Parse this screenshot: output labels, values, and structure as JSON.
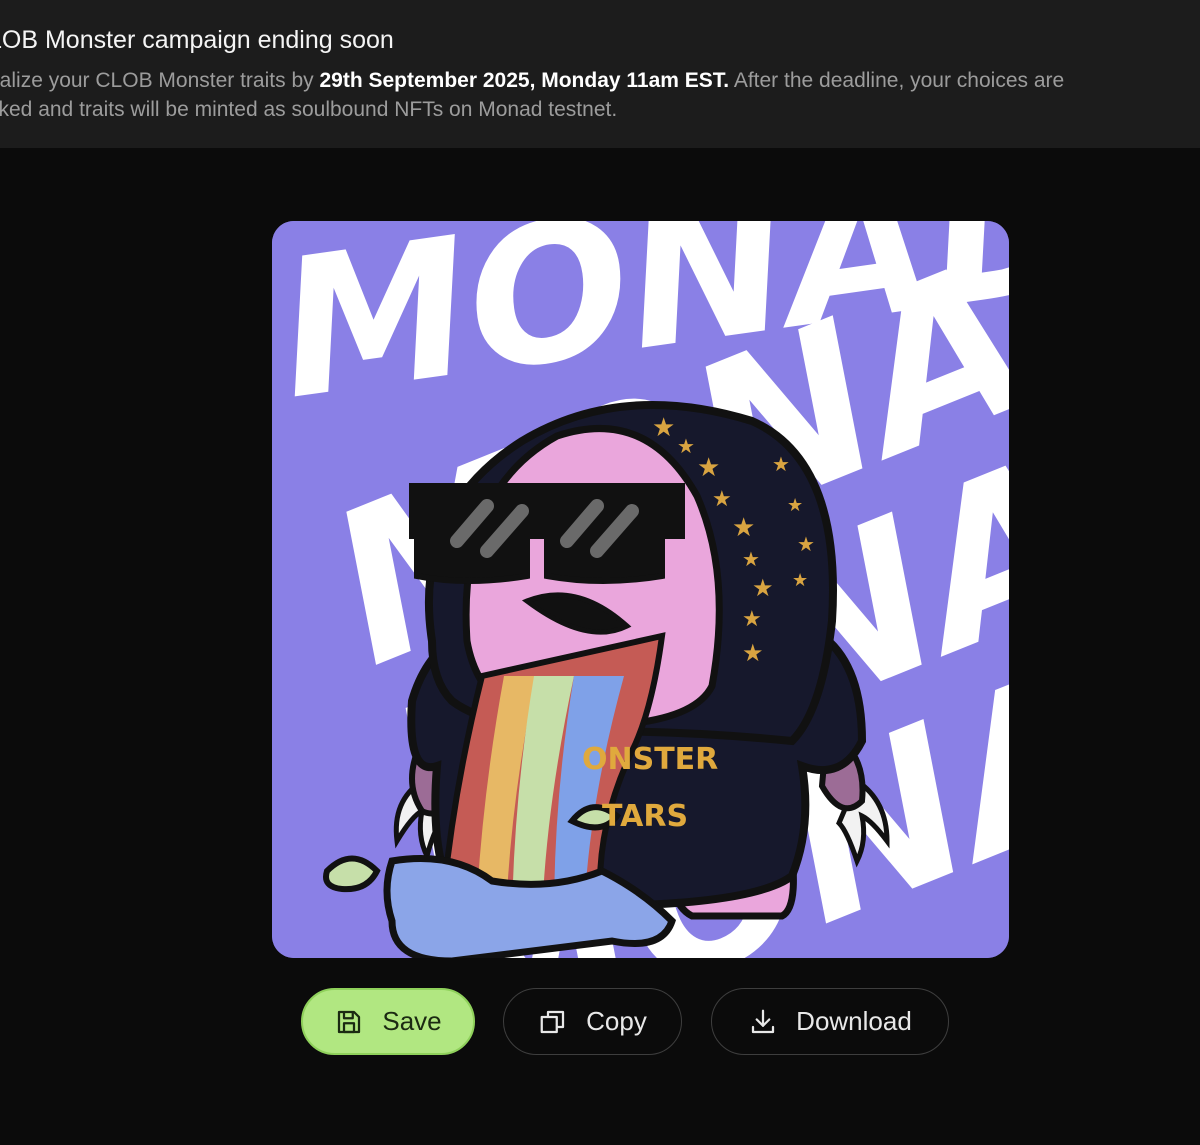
{
  "banner": {
    "title": "LOB Monster campaign ending soon",
    "body_prefix": "nalize your CLOB Monster traits by ",
    "deadline": "29th September 2025, Monday 11am EST.",
    "body_suffix": " After the deadline, your choices are",
    "body_line2": "cked and traits will be minted as soulbound NFTs on Monad testnet."
  },
  "nft": {
    "background_word": "MONAD",
    "hoodie_text_line1": "ONSTER",
    "hoodie_text_line2": "TARS",
    "background_color": "#8a80e6"
  },
  "actions": {
    "save_label": "Save",
    "copy_label": "Copy",
    "download_label": "Download",
    "save_icon": "floppy-disk-icon",
    "copy_icon": "copy-icon",
    "download_icon": "download-icon",
    "accent": "#b1e781"
  }
}
